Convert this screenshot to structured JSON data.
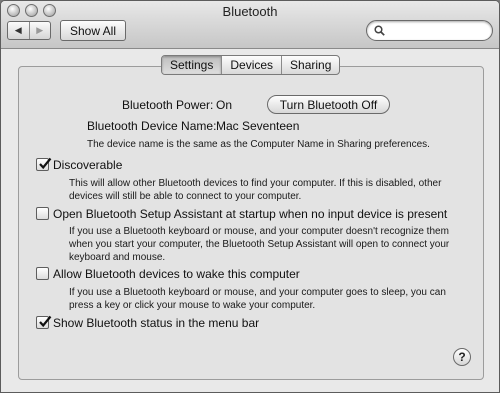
{
  "window": {
    "title": "Bluetooth"
  },
  "toolbar": {
    "back_glyph": "◀",
    "forward_glyph": "▶",
    "show_all_label": "Show All",
    "search": {
      "value": "",
      "placeholder": ""
    }
  },
  "tabs": [
    {
      "label": "Settings",
      "active": true
    },
    {
      "label": "Devices",
      "active": false
    },
    {
      "label": "Sharing",
      "active": false
    }
  ],
  "settings": {
    "power_label": "Bluetooth Power:",
    "power_value": "On",
    "power_button": "Turn Bluetooth Off",
    "device_name_label": "Bluetooth Device Name:",
    "device_name_value": "Mac Seventeen",
    "device_name_note": "The device name is the same as the Computer Name in Sharing preferences."
  },
  "options": [
    {
      "label": "Discoverable",
      "checked": true,
      "description": "This will allow other Bluetooth devices to find your computer.  If this is disabled, other devices will still be able to connect to your computer."
    },
    {
      "label": "Open Bluetooth Setup Assistant at startup when no input device is present",
      "checked": false,
      "description": "If you use a Bluetooth keyboard or mouse, and your computer doesn't recognize them when you start your computer, the Bluetooth Setup Assistant will open to connect your keyboard and mouse."
    },
    {
      "label": "Allow Bluetooth devices to wake this computer",
      "checked": false,
      "description": "If you use a Bluetooth keyboard or mouse, and your computer goes to sleep, you can press a key or click your mouse to wake your computer."
    },
    {
      "label": "Show Bluetooth status in the menu bar",
      "checked": true,
      "description": ""
    }
  ],
  "help_glyph": "?"
}
